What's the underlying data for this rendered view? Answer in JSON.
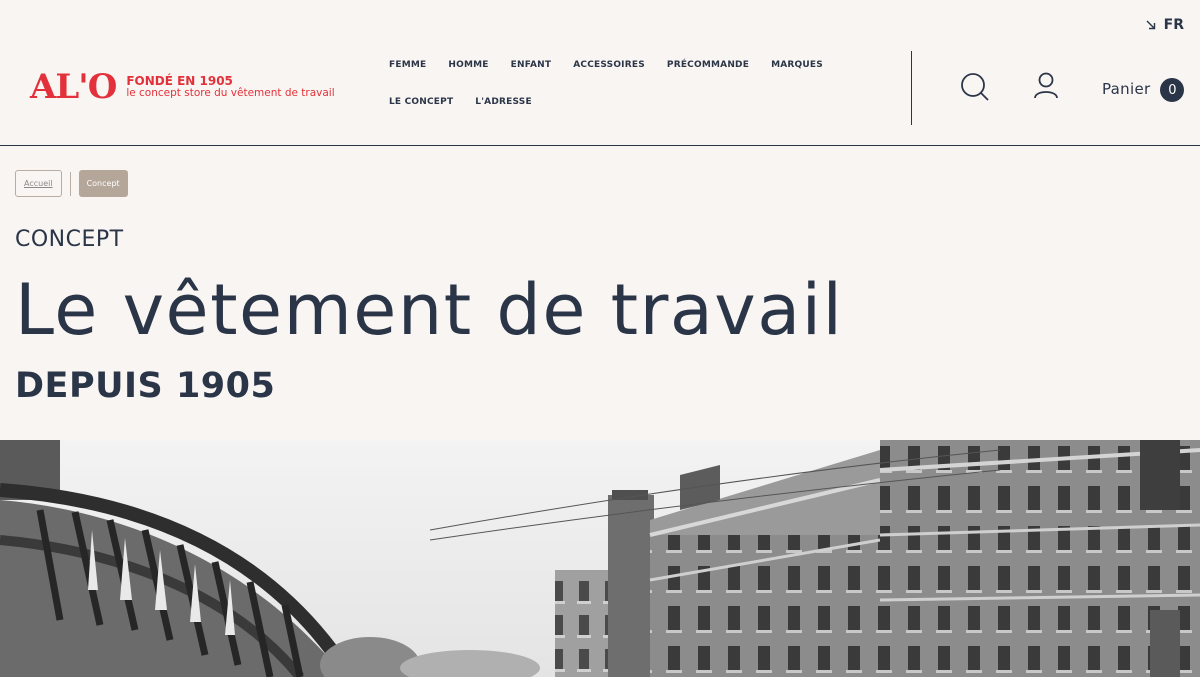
{
  "header": {
    "language": "FR",
    "logo": {
      "mark": "AL'O",
      "founded": "FONDÉ EN 1905",
      "tagline": "le concept store du vêtement de travail"
    },
    "nav": [
      {
        "label": "FEMME"
      },
      {
        "label": "HOMME"
      },
      {
        "label": "ENFANT"
      },
      {
        "label": "ACCESSOIRES"
      },
      {
        "label": "PRÉCOMMANDE"
      },
      {
        "label": "MARQUES"
      },
      {
        "label": "LE CONCEPT"
      },
      {
        "label": "L'ADRESSE"
      }
    ],
    "cart": {
      "label": "Panier",
      "count": "0"
    }
  },
  "breadcrumb": {
    "home": "Accueil",
    "current": "Concept"
  },
  "page": {
    "kicker": "CONCEPT",
    "title": "Le vêtement de travail",
    "subtitle": "DEPUIS 1905"
  },
  "colors": {
    "background": "#f9f5f2",
    "text": "#2b3548",
    "brand_red": "#e2313a",
    "crumb_active": "#b5a69a"
  },
  "icons": {
    "language": "arrow-down-right-icon",
    "search": "search-icon",
    "account": "user-icon"
  }
}
